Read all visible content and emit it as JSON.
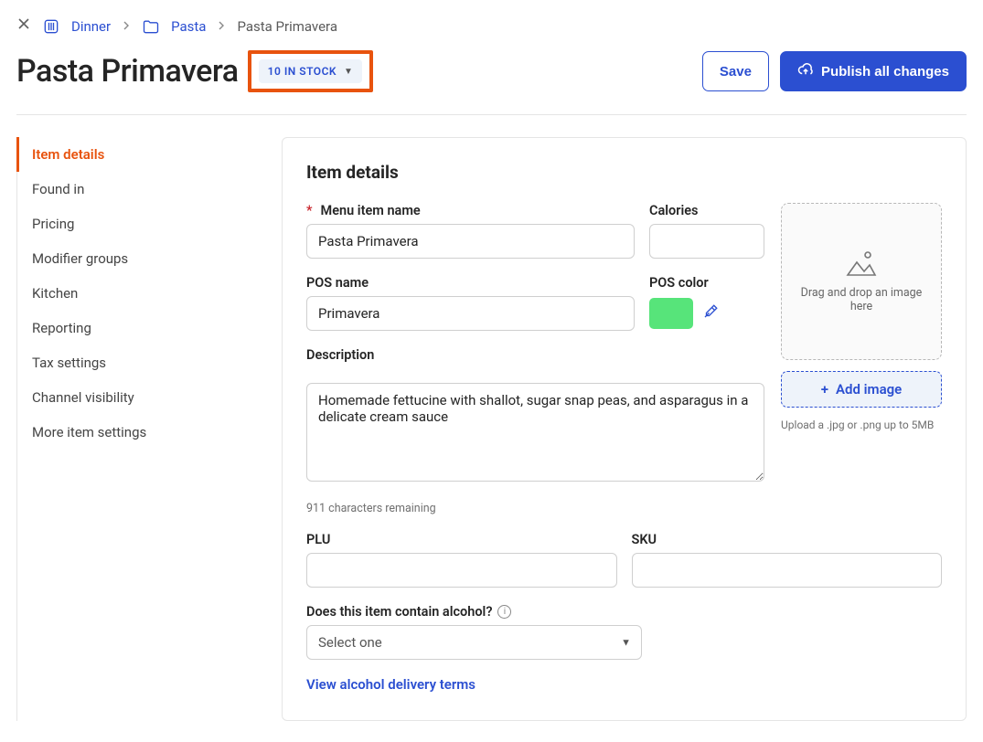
{
  "breadcrumb": {
    "level1": "Dinner",
    "level2": "Pasta",
    "current": "Pasta Primavera"
  },
  "header": {
    "title": "Pasta Primavera",
    "stock_label": "10 IN STOCK",
    "save_label": "Save",
    "publish_label": "Publish all changes"
  },
  "sidenav": {
    "items": [
      "Item details",
      "Found in",
      "Pricing",
      "Modifier groups",
      "Kitchen",
      "Reporting",
      "Tax settings",
      "Channel visibility",
      "More item settings"
    ]
  },
  "section": {
    "title": "Item details",
    "labels": {
      "menu_item_name": "Menu item name",
      "calories": "Calories",
      "pos_name": "POS name",
      "pos_color": "POS color",
      "description": "Description",
      "plu": "PLU",
      "sku": "SKU",
      "alcohol_q": "Does this item contain alcohol?"
    },
    "values": {
      "menu_item_name": "Pasta Primavera",
      "calories": "",
      "pos_name": "Primavera",
      "description": "Homemade fettucine with shallot, sugar snap peas, and asparagus in a delicate cream sauce",
      "plu": "",
      "sku": "",
      "alcohol_select": "Select one",
      "pos_color": "#57E47A"
    },
    "helpers": {
      "chars_remaining": "911 characters remaining",
      "upload_hint": "Upload a .jpg or .png up to 5MB",
      "dropzone": "Drag and drop an image here"
    },
    "buttons": {
      "add_image": "Add image"
    },
    "links": {
      "alcohol_terms": "View alcohol delivery terms"
    }
  }
}
